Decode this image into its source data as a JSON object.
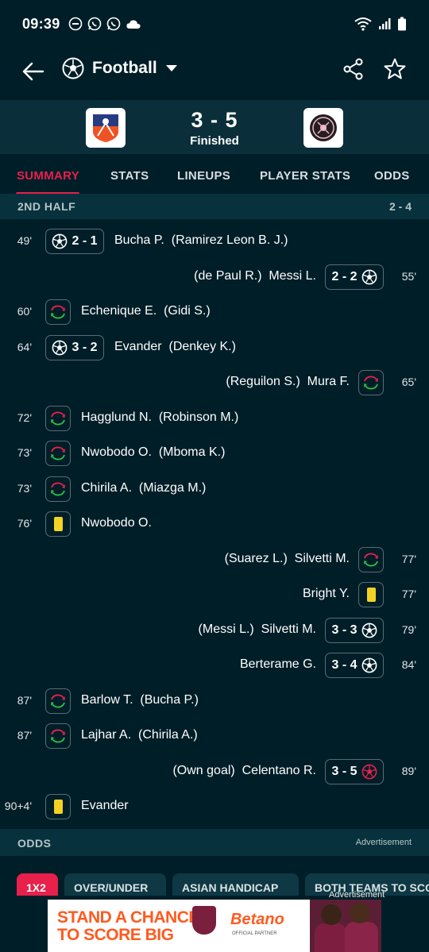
{
  "status_bar": {
    "time": "09:39"
  },
  "app_bar": {
    "sport": "Football"
  },
  "match": {
    "score": "3 - 5",
    "status": "Finished"
  },
  "tabs": [
    "SUMMARY",
    "STATS",
    "LINEUPS",
    "PLAYER STATS",
    "ODDS"
  ],
  "half": {
    "label": "2ND HALF",
    "score": "2 - 4"
  },
  "events": [
    {
      "minute": "49'",
      "side": "home",
      "type": "goal",
      "score": "2 - 1",
      "player": "Bucha P.",
      "assist": "(Ramirez Leon B. J.)"
    },
    {
      "minute": "55'",
      "side": "away",
      "type": "goal",
      "score": "2 - 2",
      "player": "Messi L.",
      "assist": "(de Paul R.)"
    },
    {
      "minute": "60'",
      "side": "home",
      "type": "sub",
      "player": "Echenique E.",
      "assist": "(Gidi S.)"
    },
    {
      "minute": "64'",
      "side": "home",
      "type": "goal",
      "score": "3 - 2",
      "player": "Evander",
      "assist": "(Denkey K.)"
    },
    {
      "minute": "65'",
      "side": "away",
      "type": "sub",
      "player": "Mura F.",
      "assist": "(Reguilon S.)"
    },
    {
      "minute": "72'",
      "side": "home",
      "type": "sub",
      "player": "Hagglund N.",
      "assist": "(Robinson M.)"
    },
    {
      "minute": "73'",
      "side": "home",
      "type": "sub",
      "player": "Nwobodo O.",
      "assist": "(Mboma K.)"
    },
    {
      "minute": "73'",
      "side": "home",
      "type": "sub",
      "player": "Chirila A.",
      "assist": "(Miazga M.)"
    },
    {
      "minute": "76'",
      "side": "home",
      "type": "yellow",
      "player": "Nwobodo O.",
      "assist": ""
    },
    {
      "minute": "77'",
      "side": "away",
      "type": "sub",
      "player": "Silvetti M.",
      "assist": "(Suarez L.)"
    },
    {
      "minute": "77'",
      "side": "away",
      "type": "yellow",
      "player": "Bright Y.",
      "assist": ""
    },
    {
      "minute": "79'",
      "side": "away",
      "type": "goal",
      "score": "3 - 3",
      "player": "Silvetti M.",
      "assist": "(Messi L.)"
    },
    {
      "minute": "84'",
      "side": "away",
      "type": "goal",
      "score": "3 - 4",
      "player": "Berterame G.",
      "assist": ""
    },
    {
      "minute": "87'",
      "side": "home",
      "type": "sub",
      "player": "Barlow T.",
      "assist": "(Bucha P.)"
    },
    {
      "minute": "87'",
      "side": "home",
      "type": "sub",
      "player": "Lajhar A.",
      "assist": "(Chirila A.)"
    },
    {
      "minute": "89'",
      "side": "away",
      "type": "owngoal",
      "score": "3 - 5",
      "player": "Celentano R.",
      "assist": "(Own goal)"
    },
    {
      "minute": "90+4'",
      "side": "home",
      "type": "yellow",
      "player": "Evander",
      "assist": ""
    }
  ],
  "odds": {
    "label": "ODDS",
    "ad_note": "Advertisement",
    "pills": [
      "1X2",
      "OVER/UNDER",
      "ASIAN HANDICAP",
      "BOTH TEAMS TO SCORE"
    ]
  },
  "ad": {
    "label": "Advertisement",
    "headline_1": "STAND A CHANCE",
    "headline_2": "TO SCORE BIG",
    "brand": "Betano",
    "partner": "OFFICIAL PARTNER"
  },
  "colors": {
    "background": "#001e28",
    "accent": "#e8204b",
    "yellow_card": "#f4d225",
    "sub_in": "#2fbf4a",
    "sub_out": "#e8204b"
  }
}
